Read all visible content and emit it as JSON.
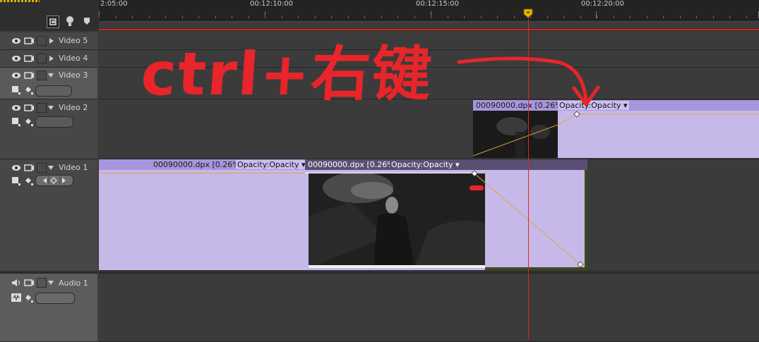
{
  "ruler": {
    "labels": [
      "2:05:00",
      "00:12:10:00",
      "00:12:15:00",
      "00:12:20:00"
    ]
  },
  "tracks": {
    "video5": {
      "name": "Video 5"
    },
    "video4": {
      "name": "Video 4"
    },
    "video3": {
      "name": "Video 3"
    },
    "video2": {
      "name": "Video 2"
    },
    "video1": {
      "name": "Video 1"
    },
    "audio1": {
      "name": "Audio 1"
    }
  },
  "clips": {
    "v2_clip": {
      "name": "00090000.dpx [0.26%]",
      "effect": "Opacity:Opacity"
    },
    "v1_clip_a": {
      "name": "00090000.dpx [0.26%]",
      "effect": "Opacity:Opacity"
    },
    "v1_clip_b": {
      "name": "00090000.dpx [0.26%]",
      "effect": "Opacity:Opacity"
    }
  },
  "annotation": {
    "text": "ctrl+右键"
  },
  "colors": {
    "clip_body": "#c6b9ea",
    "clip_header": "#a796dc",
    "playhead": "#d9291b",
    "annotation": "#e8252a",
    "keyframe_line": "#e0a23a"
  }
}
